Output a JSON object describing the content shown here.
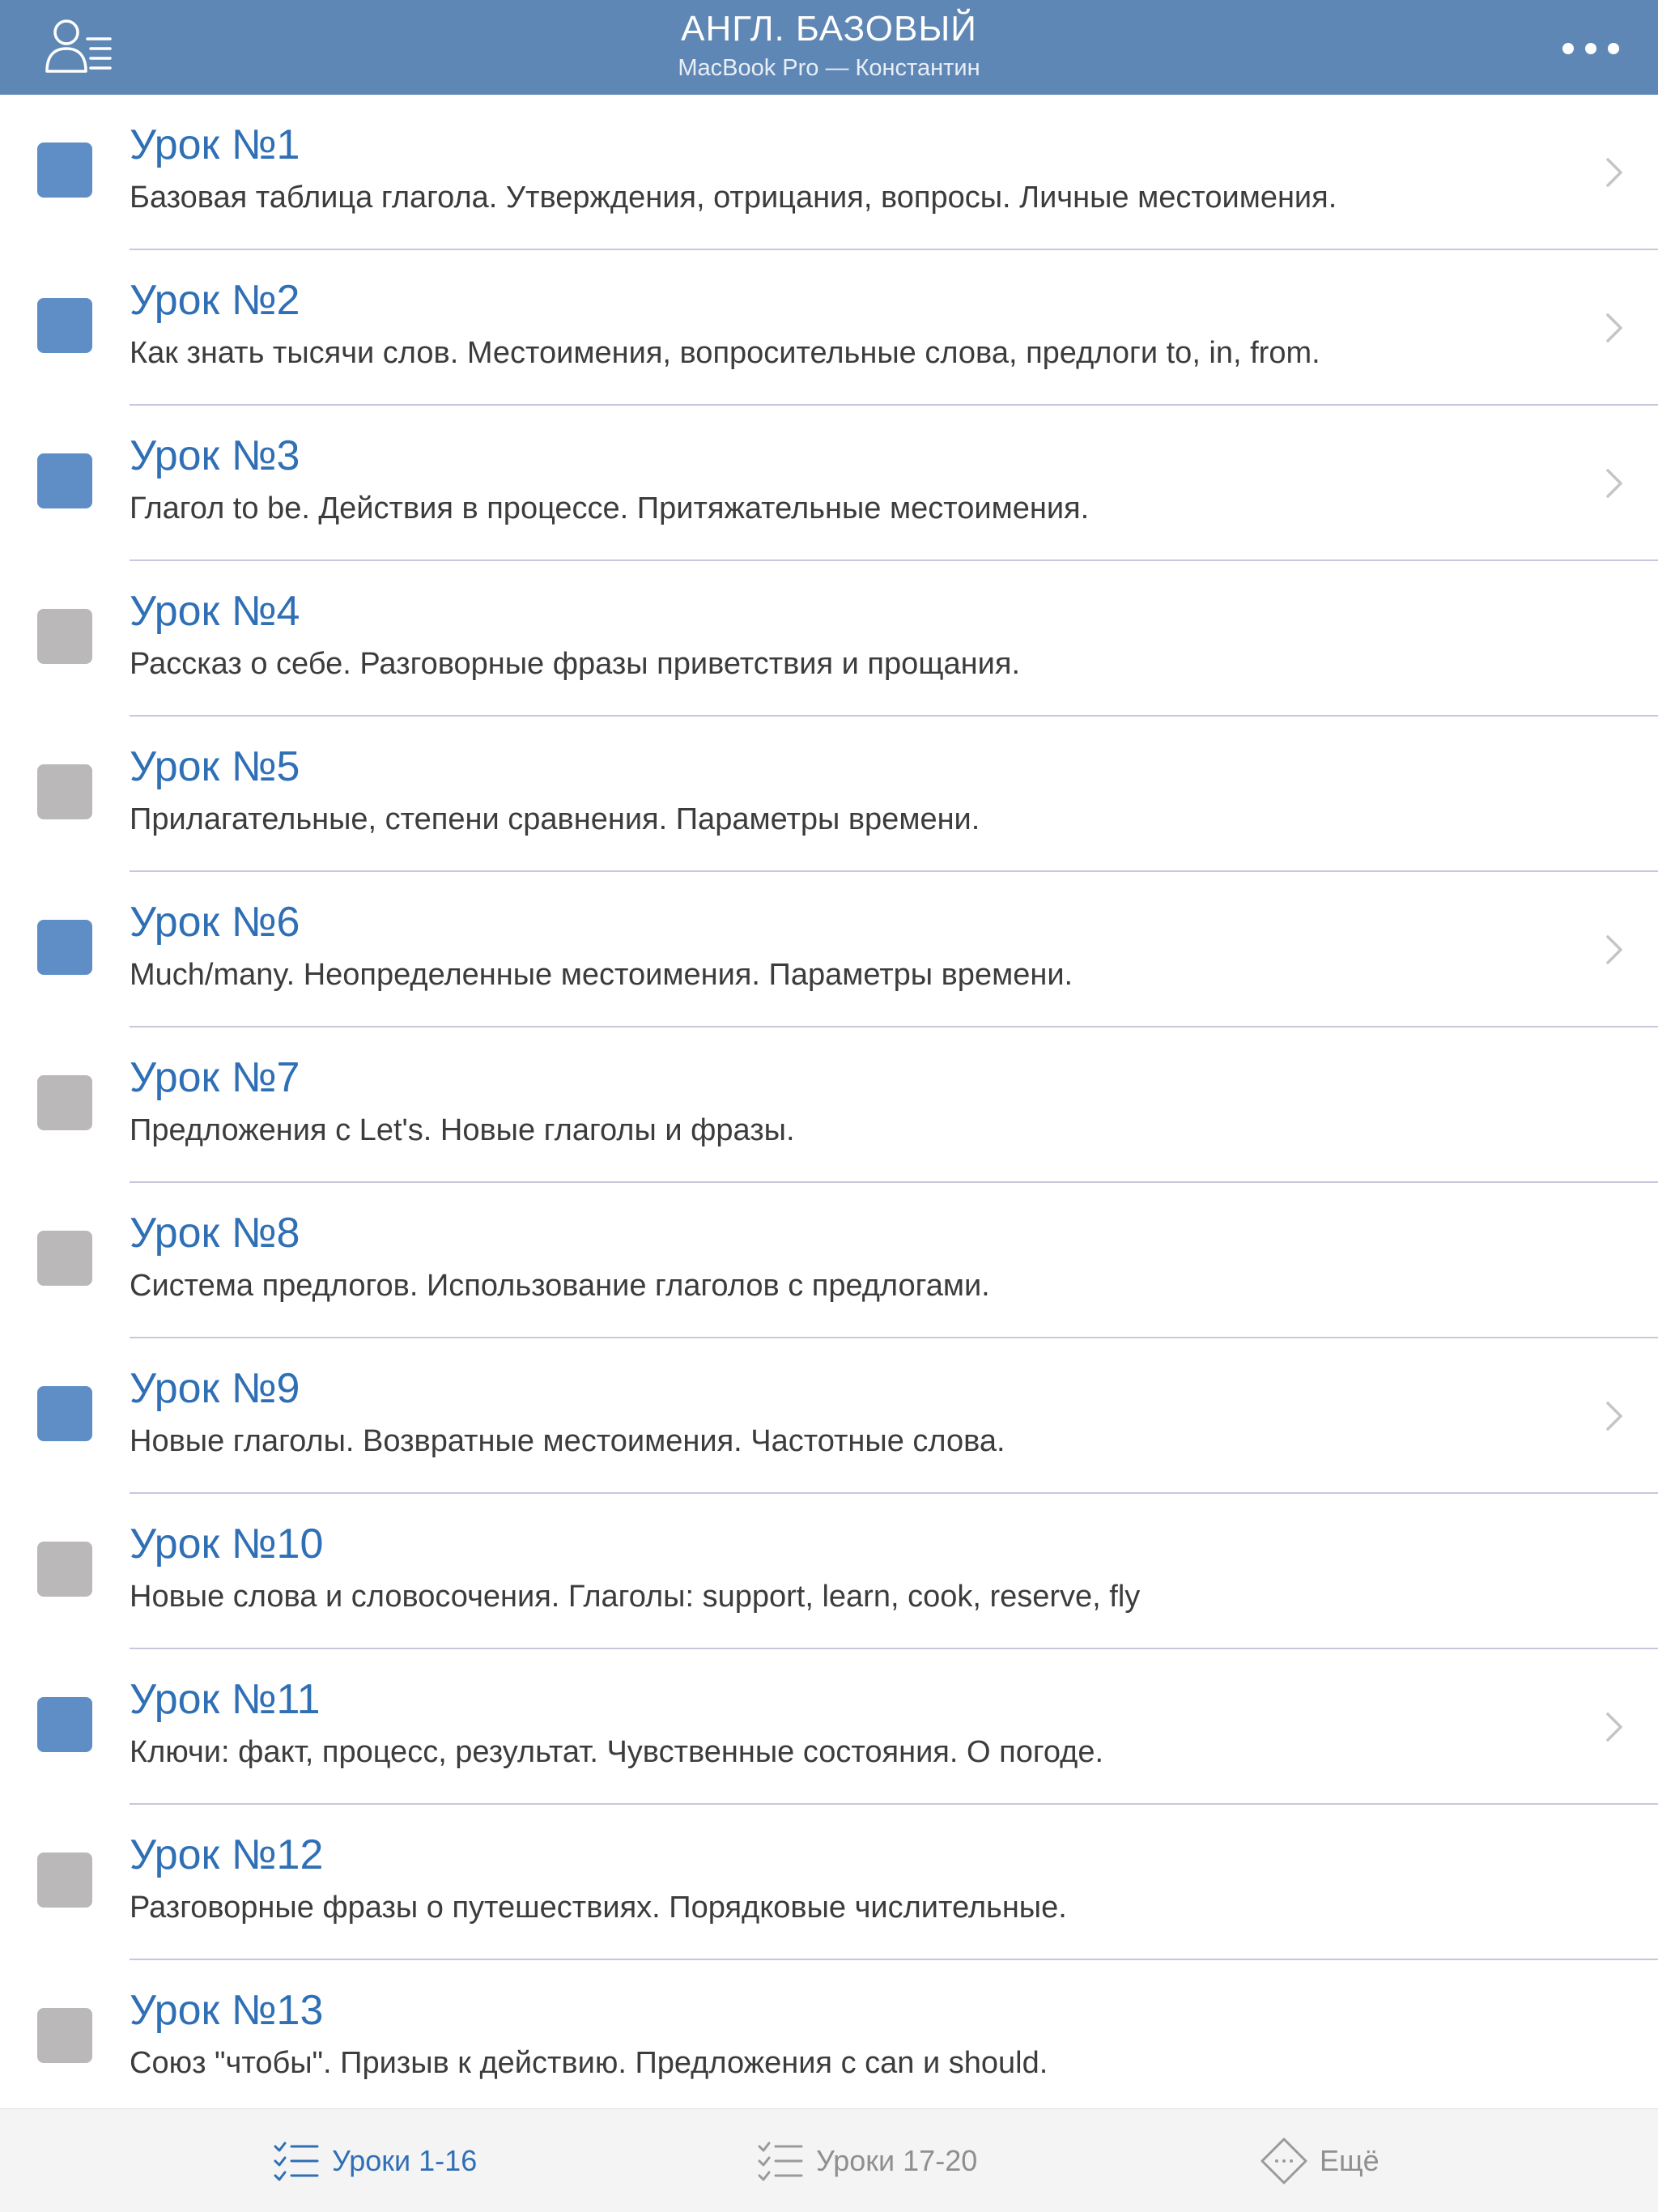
{
  "header": {
    "title": "АНГЛ. БАЗОВЫЙ",
    "subtitle": "MacBook Pro — Константин",
    "profile_icon": "user-list-icon",
    "more_icon": "more-dots-icon",
    "background_color": "#5f87b5"
  },
  "colors": {
    "accent": "#2f6fb5",
    "status_done": "#5f8ec7",
    "status_todo": "#bab8b8",
    "divider": "#c8c7dc"
  },
  "lessons": [
    {
      "title": "Урок №1",
      "description": "Базовая таблица глагола. Утверждения, отрицания, вопросы. Личные местоимения.",
      "status": "done",
      "has_chevron": true
    },
    {
      "title": "Урок №2",
      "description": "Как знать тысячи слов.  Местоимения, вопросительные слова, предлоги  to, in, from.",
      "status": "done",
      "has_chevron": true
    },
    {
      "title": "Урок №3",
      "description": "Глагол to be. Действия в процессе. Притяжательные местоимения.",
      "status": "done",
      "has_chevron": true
    },
    {
      "title": "Урок №4",
      "description": "Рассказ о себе. Разговорные фразы приветствия и прощания.",
      "status": "todo",
      "has_chevron": false
    },
    {
      "title": "Урок №5",
      "description": "Прилагательные, степени сравнения. Параметры времени.",
      "status": "todo",
      "has_chevron": false
    },
    {
      "title": "Урок №6",
      "description": "Much/many. Неопределенные местоимения. Параметры времени.",
      "status": "done",
      "has_chevron": true
    },
    {
      "title": "Урок №7",
      "description": "Предложения с Let's. Новые глаголы и фразы.",
      "status": "todo",
      "has_chevron": false
    },
    {
      "title": "Урок №8",
      "description": "Система предлогов. Использование глаголов с предлогами.",
      "status": "todo",
      "has_chevron": false
    },
    {
      "title": "Урок №9",
      "description": "Новые глаголы. Возвратные местоимения. Частотные слова.",
      "status": "done",
      "has_chevron": true
    },
    {
      "title": "Урок №10",
      "description": "Новые слова и словосочения. Глаголы: support, learn, cook, reserve, fly",
      "status": "todo",
      "has_chevron": false
    },
    {
      "title": "Урок №11",
      "description": "Ключи: факт, процесс, результат. Чувственные состояния. О погоде.",
      "status": "done",
      "has_chevron": true
    },
    {
      "title": "Урок №12",
      "description": "Разговорные фразы о путешествиях. Порядковые числительные.",
      "status": "todo",
      "has_chevron": false
    },
    {
      "title": "Урок №13",
      "description": "Союз \"чтобы\". Призыв к действию. Предложения с can и should.",
      "status": "todo",
      "has_chevron": false
    }
  ],
  "tabbar": {
    "tabs": [
      {
        "label": "Уроки 1-16",
        "icon": "checklist-icon",
        "active": true
      },
      {
        "label": "Уроки 17-20",
        "icon": "checklist-icon",
        "active": false
      },
      {
        "label": "Ещё",
        "icon": "more-diamond-icon",
        "active": false
      }
    ]
  }
}
